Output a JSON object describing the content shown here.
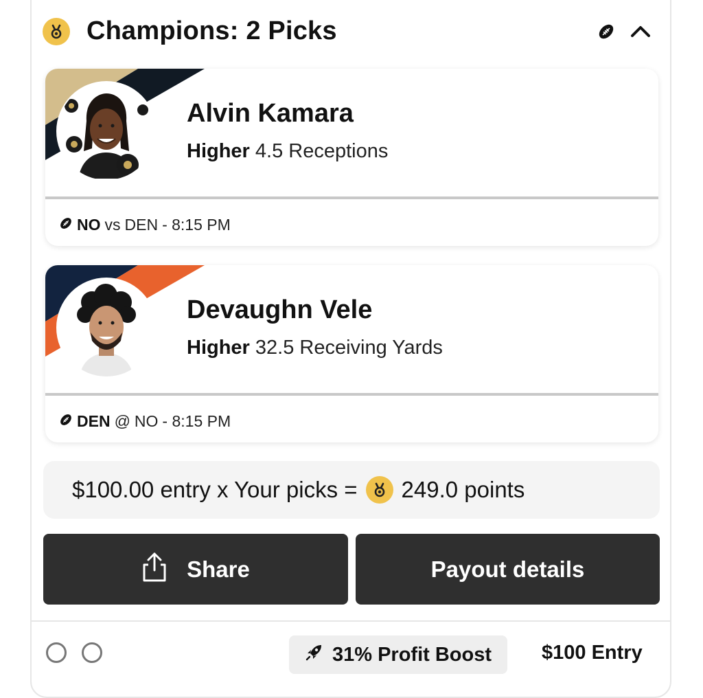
{
  "header": {
    "title": "Champions: 2 Picks"
  },
  "picks": [
    {
      "player": "Alvin Kamara",
      "direction": "Higher",
      "line": "4.5 Receptions",
      "team": "NO",
      "separator": "vs",
      "opponent": "DEN",
      "time": "- 8:15 PM",
      "stripe_colors": [
        "#d3bd8c",
        "#111a24"
      ]
    },
    {
      "player": "Devaughn Vele",
      "direction": "Higher",
      "line": "32.5 Receiving Yards",
      "team": "DEN",
      "separator": "@",
      "opponent": "NO",
      "time": "- 8:15 PM",
      "stripe_colors": [
        "#12233f",
        "#e8622d"
      ]
    }
  ],
  "summary": {
    "left": "$100.00 entry x Your picks =",
    "points": "249.0 points"
  },
  "buttons": {
    "share": "Share",
    "payout": "Payout details"
  },
  "footer": {
    "boost": "31% Profit Boost",
    "entry": "$100 Entry"
  },
  "icons": {
    "medal": "medal-icon",
    "football": "football-icon",
    "chevron": "chevron-up-icon",
    "share": "share-icon",
    "rocket": "rocket-icon"
  },
  "colors": {
    "gold": "#f0c24b",
    "button_bg": "#2f2f2f"
  }
}
